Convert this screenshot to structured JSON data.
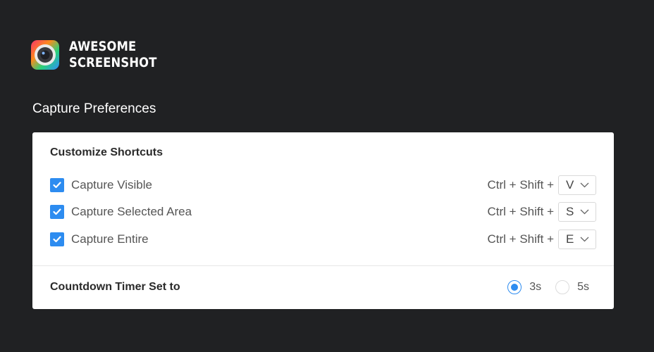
{
  "brand": {
    "logo_line1": "AWESOME",
    "logo_line2": "SCREENSHOT",
    "logo_icon": "camera-lens-icon"
  },
  "section_title": "Capture Preferences",
  "shortcuts": {
    "header": "Customize Shortcuts",
    "prefix": "Ctrl + Shift +",
    "items": [
      {
        "label": "Capture Visible",
        "checked": true,
        "key": "V"
      },
      {
        "label": "Capture Selected Area",
        "checked": true,
        "key": "S"
      },
      {
        "label": "Capture Entire",
        "checked": true,
        "key": "E"
      }
    ]
  },
  "countdown": {
    "label": "Countdown Timer Set to",
    "options": [
      "3s",
      "5s"
    ],
    "selected": "3s"
  },
  "colors": {
    "background": "#202123",
    "accent": "#2d8cf0",
    "card": "#ffffff"
  }
}
